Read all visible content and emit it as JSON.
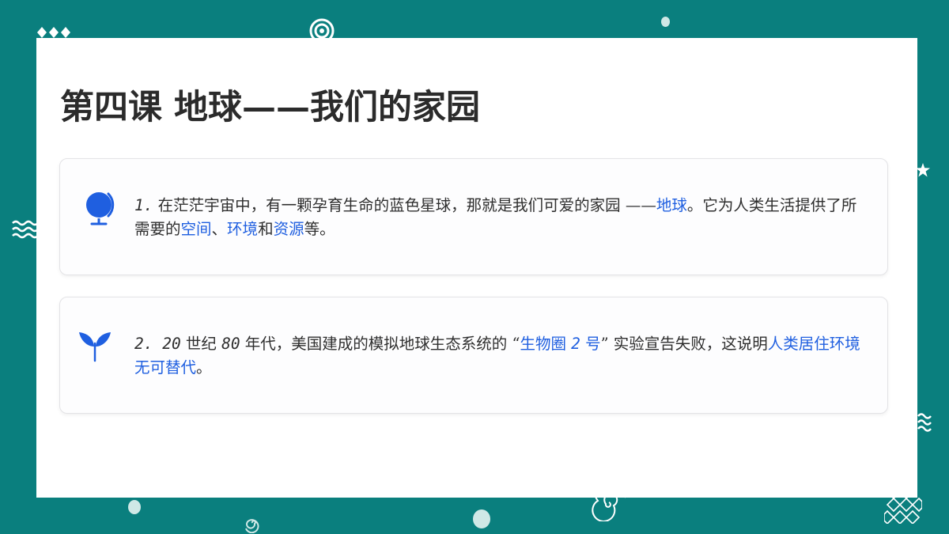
{
  "slide": {
    "title": "第四课  地球——我们的家园",
    "cards": [
      {
        "icon": "globe-icon",
        "number": "1.",
        "segments": [
          {
            "text": " 在茫茫宇宙中，有一颗孕育生命的蓝色星球，那就是我们可爱的家园 ——",
            "highlight": false
          },
          {
            "text": "地球",
            "highlight": true
          },
          {
            "text": "。它为人类生活提供了所需要的",
            "highlight": false
          },
          {
            "text": "空间",
            "highlight": true
          },
          {
            "text": "、",
            "highlight": false
          },
          {
            "text": "环境",
            "highlight": true
          },
          {
            "text": "和",
            "highlight": false
          },
          {
            "text": "资源",
            "highlight": true
          },
          {
            "text": "等。",
            "highlight": false
          }
        ]
      },
      {
        "icon": "sprout-icon",
        "number": "2. 20",
        "segments": [
          {
            "text": " 世纪 ",
            "highlight": false
          },
          {
            "text": "80",
            "highlight": false,
            "numeric": true
          },
          {
            "text": " 年代，美国建成的模拟地球生态系统的 “",
            "highlight": false
          },
          {
            "text": "生物圈 ",
            "highlight": true
          },
          {
            "text": "2",
            "highlight": true,
            "numeric": true
          },
          {
            "text": " 号",
            "highlight": true
          },
          {
            "text": "” 实验宣告失败，这说明",
            "highlight": false
          },
          {
            "text": "人类居住环境无可替代",
            "highlight": true
          },
          {
            "text": "。",
            "highlight": false
          }
        ]
      }
    ]
  },
  "colors": {
    "background": "#0a7f7e",
    "highlight": "#1f5fe0",
    "icon": "#1f5fe0",
    "text": "#2e2e2e"
  }
}
